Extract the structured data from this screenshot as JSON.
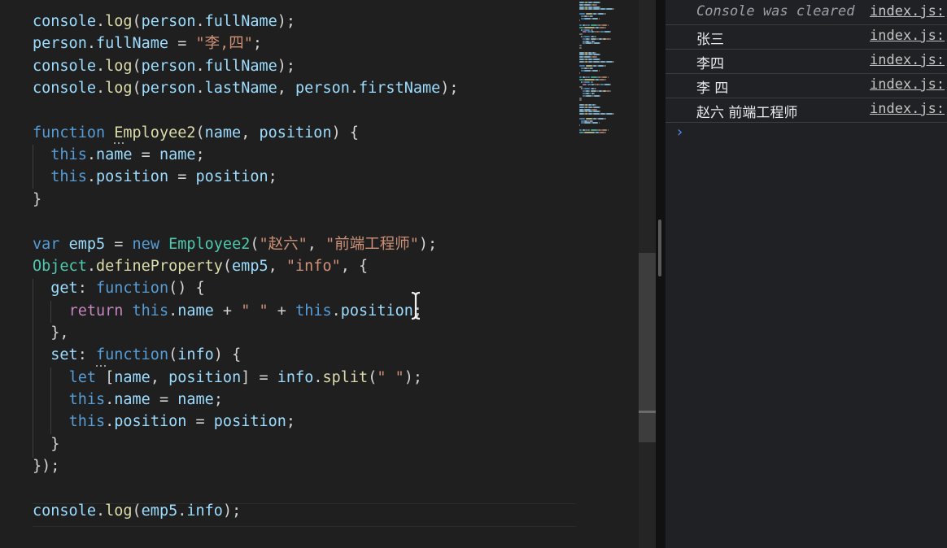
{
  "editor": {
    "lines": [
      [
        [
          "var",
          "console"
        ],
        [
          "pun",
          "."
        ],
        [
          "fn",
          "log"
        ],
        [
          "pun",
          "("
        ],
        [
          "var",
          "person"
        ],
        [
          "pun",
          "."
        ],
        [
          "var",
          "fullName"
        ],
        [
          "pun",
          ");"
        ]
      ],
      [
        [
          "var",
          "person"
        ],
        [
          "pun",
          "."
        ],
        [
          "var",
          "fullName"
        ],
        [
          "pun",
          " = "
        ],
        [
          "str",
          "\"李,四\""
        ],
        [
          "pun",
          ";"
        ]
      ],
      [
        [
          "var",
          "console"
        ],
        [
          "pun",
          "."
        ],
        [
          "fn",
          "log"
        ],
        [
          "pun",
          "("
        ],
        [
          "var",
          "person"
        ],
        [
          "pun",
          "."
        ],
        [
          "var",
          "fullName"
        ],
        [
          "pun",
          ");"
        ]
      ],
      [
        [
          "var",
          "console"
        ],
        [
          "pun",
          "."
        ],
        [
          "fn",
          "log"
        ],
        [
          "pun",
          "("
        ],
        [
          "var",
          "person"
        ],
        [
          "pun",
          "."
        ],
        [
          "var",
          "lastName"
        ],
        [
          "pun",
          ", "
        ],
        [
          "var",
          "person"
        ],
        [
          "pun",
          "."
        ],
        [
          "var",
          "firstName"
        ],
        [
          "pun",
          ");"
        ]
      ],
      [],
      [
        [
          "kw",
          "function"
        ],
        [
          "pun",
          " "
        ],
        [
          "fn",
          "Employee2"
        ],
        [
          "pun",
          "("
        ],
        [
          "var",
          "name"
        ],
        [
          "pun",
          ", "
        ],
        [
          "var",
          "position"
        ],
        [
          "pun",
          ") {"
        ]
      ],
      [
        [
          "pun",
          "  "
        ],
        [
          "kw",
          "this"
        ],
        [
          "pun",
          "."
        ],
        [
          "var",
          "name"
        ],
        [
          "pun",
          " = "
        ],
        [
          "var",
          "name"
        ],
        [
          "pun",
          ";"
        ]
      ],
      [
        [
          "pun",
          "  "
        ],
        [
          "kw",
          "this"
        ],
        [
          "pun",
          "."
        ],
        [
          "var",
          "position"
        ],
        [
          "pun",
          " = "
        ],
        [
          "var",
          "position"
        ],
        [
          "pun",
          ";"
        ]
      ],
      [
        [
          "pun",
          "}"
        ]
      ],
      [],
      [
        [
          "kw",
          "var"
        ],
        [
          "pun",
          " "
        ],
        [
          "var",
          "emp5"
        ],
        [
          "pun",
          " = "
        ],
        [
          "kw",
          "new"
        ],
        [
          "pun",
          " "
        ],
        [
          "cls",
          "Employee2"
        ],
        [
          "pun",
          "("
        ],
        [
          "str",
          "\"赵六\""
        ],
        [
          "pun",
          ", "
        ],
        [
          "str",
          "\"前端工程师\""
        ],
        [
          "pun",
          ");"
        ]
      ],
      [
        [
          "cls",
          "Object"
        ],
        [
          "pun",
          "."
        ],
        [
          "fn",
          "defineProperty"
        ],
        [
          "pun",
          "("
        ],
        [
          "var",
          "emp5"
        ],
        [
          "pun",
          ", "
        ],
        [
          "str",
          "\"info\""
        ],
        [
          "pun",
          ", {"
        ]
      ],
      [
        [
          "pun",
          "  "
        ],
        [
          "var",
          "get"
        ],
        [
          "pun",
          ": "
        ],
        [
          "kw",
          "function"
        ],
        [
          "pun",
          "() {"
        ]
      ],
      [
        [
          "pun",
          "    "
        ],
        [
          "ctl",
          "return"
        ],
        [
          "pun",
          " "
        ],
        [
          "kw",
          "this"
        ],
        [
          "pun",
          "."
        ],
        [
          "var",
          "name"
        ],
        [
          "pun",
          " + "
        ],
        [
          "str",
          "\" \""
        ],
        [
          "pun",
          " + "
        ],
        [
          "kw",
          "this"
        ],
        [
          "pun",
          "."
        ],
        [
          "var",
          "position"
        ],
        [
          "pun",
          ";"
        ]
      ],
      [
        [
          "pun",
          "  },"
        ]
      ],
      [
        [
          "pun",
          "  "
        ],
        [
          "var",
          "set"
        ],
        [
          "pun",
          ": "
        ],
        [
          "kw",
          "function"
        ],
        [
          "pun",
          "("
        ],
        [
          "var",
          "info"
        ],
        [
          "pun",
          ") {"
        ]
      ],
      [
        [
          "pun",
          "    "
        ],
        [
          "kw",
          "let"
        ],
        [
          "pun",
          " ["
        ],
        [
          "var",
          "name"
        ],
        [
          "pun",
          ", "
        ],
        [
          "var",
          "position"
        ],
        [
          "pun",
          "] = "
        ],
        [
          "var",
          "info"
        ],
        [
          "pun",
          "."
        ],
        [
          "fn",
          "split"
        ],
        [
          "pun",
          "("
        ],
        [
          "str",
          "\" \""
        ],
        [
          "pun",
          ");"
        ]
      ],
      [
        [
          "pun",
          "    "
        ],
        [
          "kw",
          "this"
        ],
        [
          "pun",
          "."
        ],
        [
          "var",
          "name"
        ],
        [
          "pun",
          " = "
        ],
        [
          "var",
          "name"
        ],
        [
          "pun",
          ";"
        ]
      ],
      [
        [
          "pun",
          "    "
        ],
        [
          "kw",
          "this"
        ],
        [
          "pun",
          "."
        ],
        [
          "var",
          "position"
        ],
        [
          "pun",
          " = "
        ],
        [
          "var",
          "position"
        ],
        [
          "pun",
          ";"
        ]
      ],
      [
        [
          "pun",
          "  }"
        ]
      ],
      [
        [
          "pun",
          "});"
        ]
      ],
      [],
      [
        [
          "var",
          "console"
        ],
        [
          "pun",
          "."
        ],
        [
          "fn",
          "log"
        ],
        [
          "pun",
          "("
        ],
        [
          "var",
          "emp5"
        ],
        [
          "pun",
          "."
        ],
        [
          "var",
          "info"
        ],
        [
          "pun",
          ");"
        ]
      ]
    ]
  },
  "console": {
    "rows": [
      {
        "text": "Console was cleared",
        "source": "index.js:",
        "type": "cleared"
      },
      {
        "text": "张三",
        "source": "index.js:",
        "type": "log"
      },
      {
        "text": "李四",
        "source": "index.js:",
        "type": "log"
      },
      {
        "text": "李 四",
        "source": "index.js:",
        "type": "log"
      },
      {
        "text": "赵六 前端工程师",
        "source": "index.js:",
        "type": "log"
      }
    ],
    "prompt_icon": "chevron-right-icon"
  },
  "colors": {
    "editor_bg": "#1f1f1f",
    "console_bg": "#202124",
    "keyword": "#569cd6",
    "function": "#dcdcaa",
    "variable": "#9cdcfe",
    "string": "#ce9178",
    "class": "#4ec9b0",
    "control": "#c586c0",
    "prompt": "#4c8df6"
  }
}
